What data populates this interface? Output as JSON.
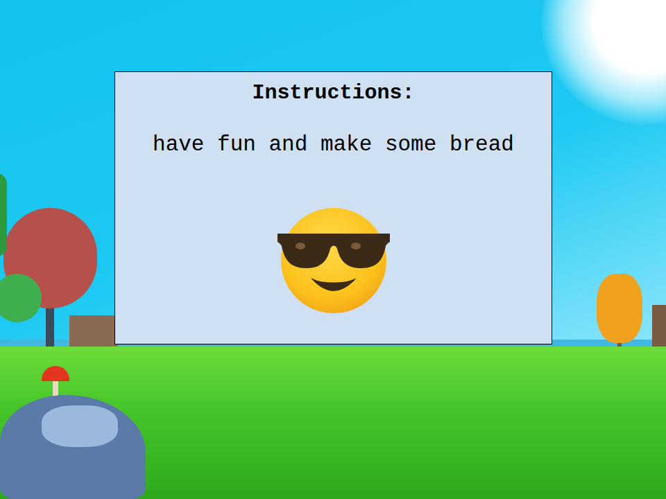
{
  "panel": {
    "title": "Instructions:",
    "text": "have fun and make some bread"
  }
}
